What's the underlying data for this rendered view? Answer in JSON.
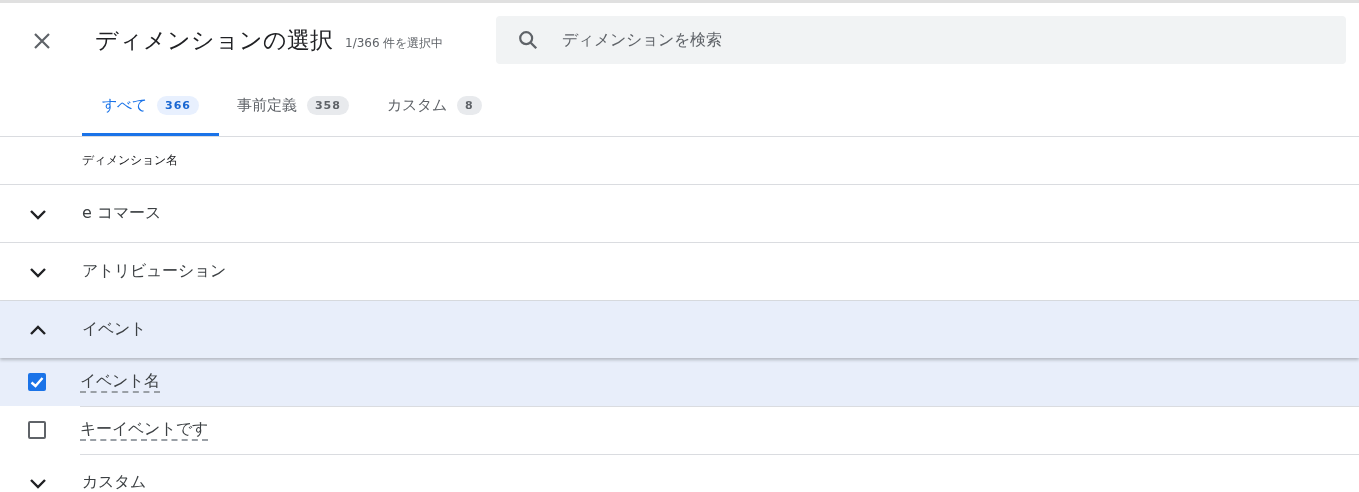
{
  "header": {
    "title": "ディメンションの選択",
    "selection_count": "1/366 件を選択中",
    "search": {
      "placeholder": "ディメンションを検索"
    }
  },
  "tabs": [
    {
      "label": "すべて",
      "count": "366",
      "selected": true
    },
    {
      "label": "事前定義",
      "count": "358",
      "selected": false
    },
    {
      "label": "カスタム",
      "count": "8",
      "selected": false
    }
  ],
  "table": {
    "column": "ディメンション名",
    "groups": [
      {
        "label": "e コマース",
        "expanded": false
      },
      {
        "label": "アトリビューション",
        "expanded": false
      },
      {
        "label": "イベント",
        "expanded": true,
        "children": [
          {
            "label": "イベント名",
            "checked": true
          },
          {
            "label": "キーイベントです",
            "checked": false
          }
        ]
      },
      {
        "label": "カスタム",
        "expanded": false
      }
    ]
  }
}
